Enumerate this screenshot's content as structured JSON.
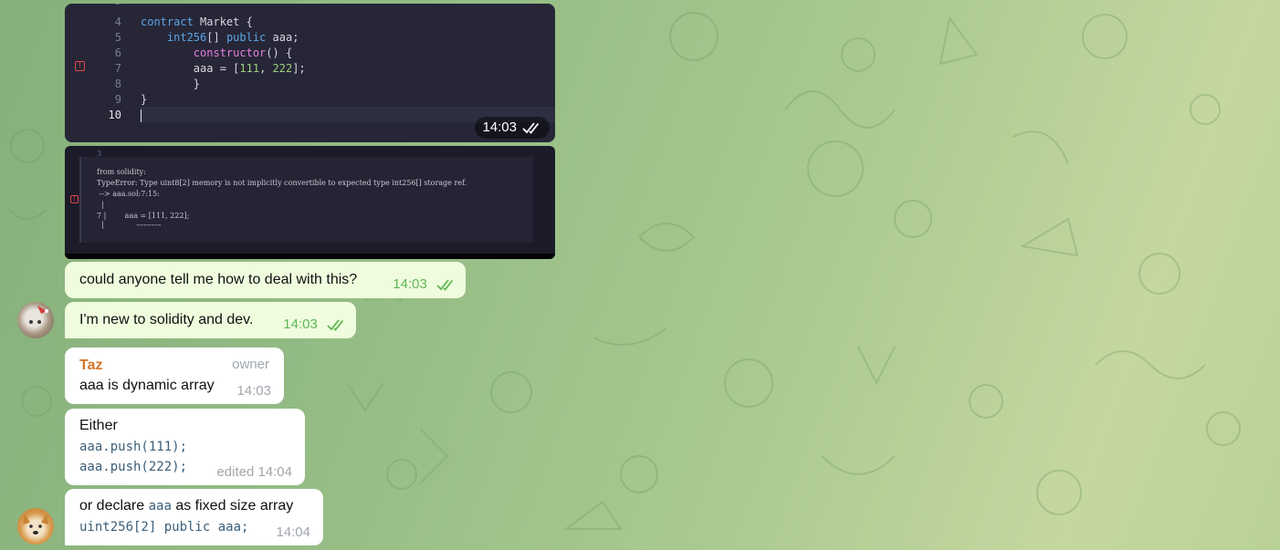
{
  "code_image": {
    "lines": [
      {
        "n": "4",
        "parts": [
          {
            "t": "contract ",
            "c": "kw"
          },
          {
            "t": "Market {",
            "c": ""
          }
        ]
      },
      {
        "n": "5",
        "parts": [
          {
            "t": "    int256",
            "c": "kw"
          },
          {
            "t": "[] ",
            "c": ""
          },
          {
            "t": "public",
            "c": "kw"
          },
          {
            "t": " aaa;",
            "c": ""
          }
        ]
      },
      {
        "n": "6",
        "parts": [
          {
            "t": "        constructor",
            "c": "fn"
          },
          {
            "t": "() {",
            "c": ""
          }
        ]
      },
      {
        "n": "7",
        "parts": [
          {
            "t": "        aaa = [",
            "c": ""
          },
          {
            "t": "111",
            "c": "num"
          },
          {
            "t": ", ",
            "c": ""
          },
          {
            "t": "222",
            "c": "num"
          },
          {
            "t": "];",
            "c": ""
          }
        ]
      },
      {
        "n": "8",
        "parts": [
          {
            "t": "        }",
            "c": ""
          }
        ]
      },
      {
        "n": "9",
        "parts": [
          {
            "t": "}",
            "c": ""
          }
        ]
      },
      {
        "n": "10",
        "parts": [
          {
            "t": "",
            "c": ""
          }
        ]
      }
    ],
    "error_marker": "!",
    "time": "14:03"
  },
  "error_image": {
    "top_number": "3",
    "lines": [
      "from solidity:",
      "TypeError: Type uint8[2] memory is not implicitly convertible to expected type int256[] storage ref.",
      " --> aaa.sol:7:15:",
      "  |",
      "7 |        aaa = [111, 222];",
      "  |              ----------"
    ],
    "error_marker": "!"
  },
  "messages": {
    "m1": {
      "text": "could anyone tell me how to deal with this?",
      "time": "14:03"
    },
    "m2": {
      "text": "I'm new to solidity and dev.",
      "time": "14:03"
    },
    "m3": {
      "sender": "Taz",
      "role": "owner",
      "text": "aaa is dynamic array",
      "time": "14:03"
    },
    "m4": {
      "text": "Either",
      "code1": "aaa.push(111);",
      "code2": "aaa.push(222);",
      "time": "edited 14:04"
    },
    "m5": {
      "text_before": "or declare ",
      "inline_code": "aaa",
      "text_after": " as fixed size array",
      "code": "uint256[2] public aaa;",
      "time": "14:04"
    }
  },
  "colors": {
    "own_bubble": "#effdde",
    "check": "#5fb754",
    "sender": "#d4762a"
  }
}
